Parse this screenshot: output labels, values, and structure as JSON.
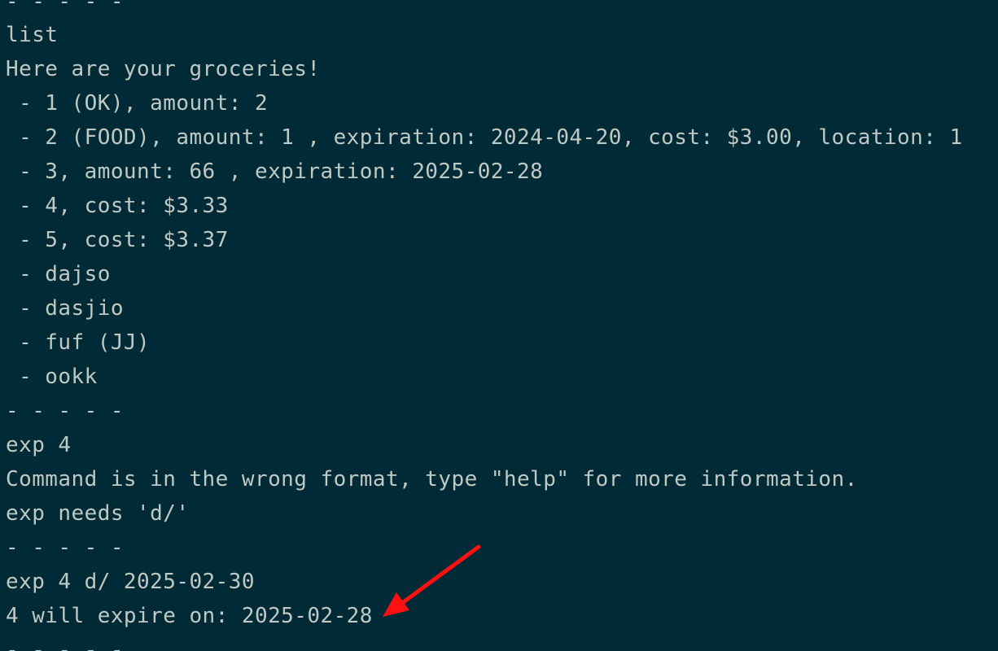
{
  "terminal": {
    "lines": [
      "- - - - -",
      "list",
      "Here are your groceries!",
      " - 1 (OK), amount: 2",
      " - 2 (FOOD), amount: 1 , expiration: 2024-04-20, cost: $3.00, location: 1",
      " - 3, amount: 66 , expiration: 2025-02-28",
      " - 4, cost: $3.33",
      " - 5, cost: $3.37",
      " - dajso",
      " - dasjio",
      " - fuf (JJ)",
      " - ookk",
      "- - - - -",
      "exp 4",
      "Command is in the wrong format, type \"help\" for more information.",
      "exp needs 'd/'",
      "- - - - -",
      "exp 4 d/ 2025-02-30",
      "4 will expire on: 2025-02-28",
      "- - - - -"
    ]
  },
  "colors": {
    "background": "#002b36",
    "text": "#c0c8c4",
    "annotation_arrow": "#ff1010"
  }
}
